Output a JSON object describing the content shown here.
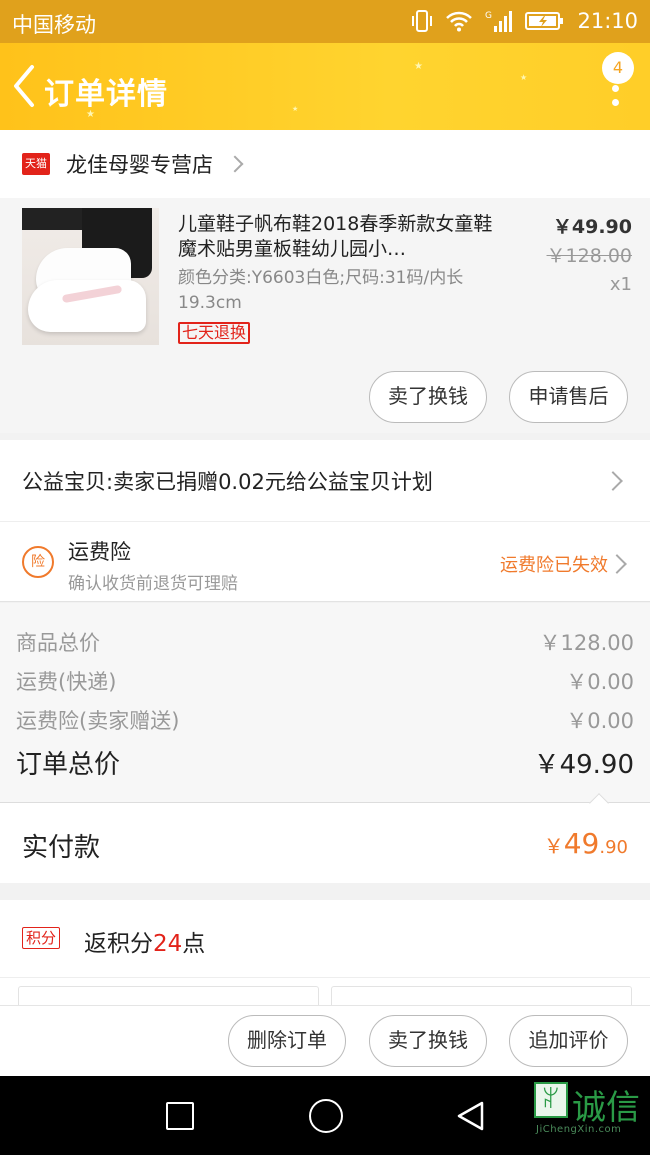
{
  "status_bar": {
    "carrier": "中国移动",
    "time": "21:10"
  },
  "nav": {
    "title": "订单详情",
    "badge_count": "4"
  },
  "shop": {
    "badge": "天猫",
    "name": "龙佳母婴专营店"
  },
  "product": {
    "title": "儿童鞋子帆布鞋2018春季新款女童鞋魔术贴男童板鞋幼儿园小…",
    "sku": "颜色分类:Y6603白色;尺码:31码/内长19.3cm",
    "tag": "七天退换",
    "price": "￥49.90",
    "original_price": "￥128.00",
    "quantity": "x1",
    "buttons": [
      "卖了换钱",
      "申请售后"
    ]
  },
  "charity": {
    "text": "公益宝贝:卖家已捐赠0.02元给公益宝贝计划"
  },
  "insurance": {
    "icon_text": "险",
    "title": "运费险",
    "subtitle": "确认收货前退货可理赔",
    "status": "运费险已失效"
  },
  "totals": {
    "rows": [
      {
        "label": "商品总价",
        "value": "￥128.00"
      },
      {
        "label": "运费(快递)",
        "value": "￥0.00"
      },
      {
        "label": "运费险(卖家赠送)",
        "value": "￥0.00"
      }
    ],
    "order_total_label": "订单总价",
    "order_total_value": "￥49.90"
  },
  "paid": {
    "label": "实付款",
    "symbol": "￥",
    "integer": "49",
    "decimal": ".90"
  },
  "points": {
    "tag": "积分",
    "prefix": "返积分",
    "count": "24",
    "suffix": "点"
  },
  "bottom_buttons": [
    "删除订单",
    "卖了换钱",
    "追加评价"
  ],
  "watermark": {
    "mark": "ꆳ",
    "text": "诚信",
    "url_text": "JiChengXin.com"
  },
  "colors": {
    "header": "#ffc81f",
    "accent_orange": "#f07a2c",
    "tmall_red": "#e2231a"
  }
}
